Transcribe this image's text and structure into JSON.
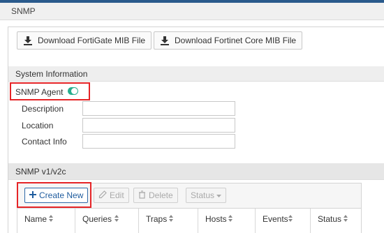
{
  "header": {
    "title": "SNMP"
  },
  "buttons": {
    "download_fortigate": "Download FortiGate MIB File",
    "download_core": "Download Fortinet Core MIB File"
  },
  "system_info": {
    "title": "System Information",
    "snmp_agent_label": "SNMP Agent",
    "snmp_agent_enabled": true,
    "fields": [
      {
        "label": "Description",
        "value": ""
      },
      {
        "label": "Location",
        "value": ""
      },
      {
        "label": "Contact Info",
        "value": ""
      }
    ]
  },
  "snmp_v1v2c": {
    "title": "SNMP v1/v2c",
    "toolbar": {
      "create_new": "Create New",
      "edit": "Edit",
      "delete": "Delete",
      "status": "Status"
    },
    "columns": [
      "Name",
      "Queries",
      "Traps",
      "Hosts",
      "Events",
      "Status"
    ]
  },
  "colors": {
    "highlight": "#e52427",
    "toggle_on": "#27ae8e",
    "primary": "#1f5c9e"
  }
}
